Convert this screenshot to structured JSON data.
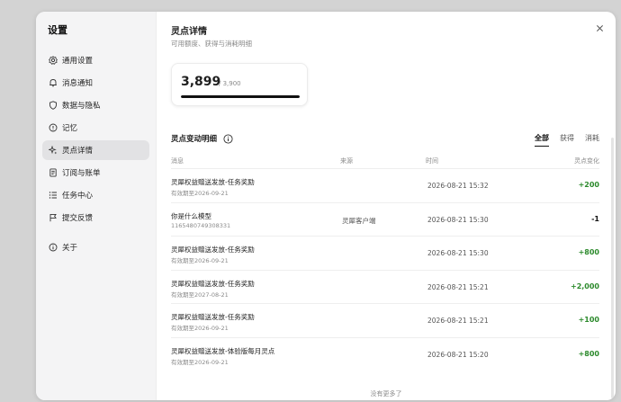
{
  "sidebar": {
    "title": "设置",
    "items": [
      {
        "label": "通用设置",
        "icon": "gear-icon"
      },
      {
        "label": "消息通知",
        "icon": "bell-icon"
      },
      {
        "label": "数据与隐私",
        "icon": "shield-icon"
      },
      {
        "label": "记忆",
        "icon": "info-circle-icon"
      },
      {
        "label": "灵点详情",
        "icon": "sparkle-icon",
        "active": true
      },
      {
        "label": "订阅与账单",
        "icon": "document-icon"
      },
      {
        "label": "任务中心",
        "icon": "list-icon"
      },
      {
        "label": "提交反馈",
        "icon": "flag-icon"
      },
      {
        "label": "关于",
        "icon": "info-icon"
      }
    ]
  },
  "main": {
    "title": "灵点详情",
    "subtitle": "可用额度、获得与消耗明细",
    "balance": {
      "value": "3,899",
      "total": "/ 3,900",
      "fraction": 0.9997
    },
    "section_title": "灵点变动明细",
    "filters": [
      "全部",
      "获得",
      "消耗"
    ],
    "columns": {
      "message": "消息",
      "source": "来源",
      "time": "时间",
      "change": "灵点变化"
    },
    "rows": [
      {
        "title": "灵犀权益赠送发放-任务奖励",
        "sub": "有效期至2026-09-21",
        "source": "",
        "time": "2026-08-21 15:32",
        "change": "+200",
        "positive": true
      },
      {
        "title": "你是什么模型",
        "sub": "1165480749308331",
        "source": "灵犀客户端",
        "time": "2026-08-21 15:30",
        "change": "-1",
        "positive": false
      },
      {
        "title": "灵犀权益赠送发放-任务奖励",
        "sub": "有效期至2026-09-21",
        "source": "",
        "time": "2026-08-21 15:30",
        "change": "+800",
        "positive": true
      },
      {
        "title": "灵犀权益赠送发放-任务奖励",
        "sub": "有效期至2027-08-21",
        "source": "",
        "time": "2026-08-21 15:21",
        "change": "+2,000",
        "positive": true
      },
      {
        "title": "灵犀权益赠送发放-任务奖励",
        "sub": "有效期至2026-09-21",
        "source": "",
        "time": "2026-08-21 15:21",
        "change": "+100",
        "positive": true
      },
      {
        "title": "灵犀权益赠送发放-体验版每月灵点",
        "sub": "有效期至2026-09-21",
        "source": "",
        "time": "2026-08-21 15:20",
        "change": "+800",
        "positive": true
      }
    ],
    "no_more": "没有更多了"
  },
  "colors": {
    "positive": "#2c8a2c",
    "negative": "#111111",
    "active_bg": "#e2e2e4"
  }
}
